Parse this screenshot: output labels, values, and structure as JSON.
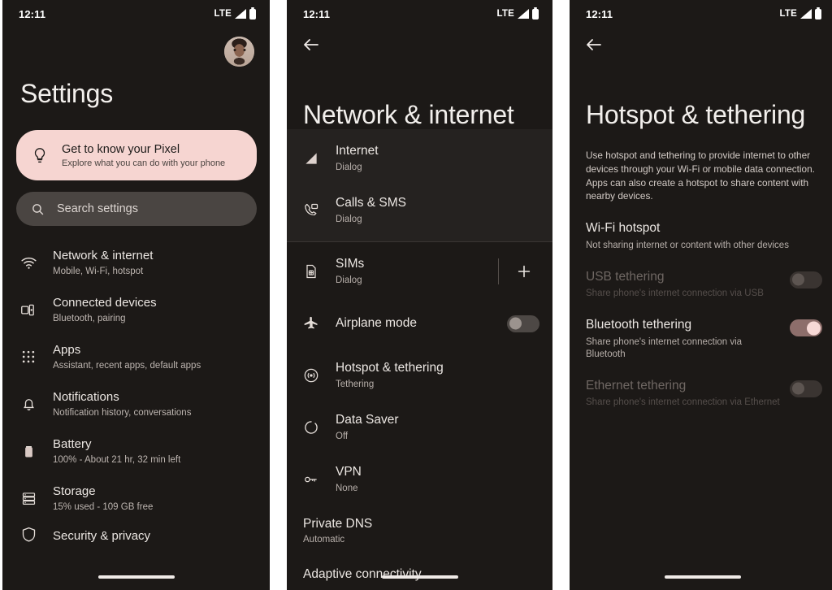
{
  "status_bar": {
    "time": "12:11",
    "network_label": "LTE",
    "signal_icon": "signal-bars-icon",
    "battery_icon": "battery-full-icon"
  },
  "colors": {
    "background": "#1c1917",
    "card_pink": "#f6d5d1",
    "search_bg": "#4a4542",
    "toggle_on_track": "#8d6e6b",
    "toggle_on_thumb": "#f7d9d6",
    "toggle_off_track": "#4d4845",
    "text_primary": "#ece7e3",
    "text_secondary": "#b7afaa"
  },
  "panel1": {
    "avatar": "user-avatar",
    "title": "Settings",
    "promo_card": {
      "icon": "lightbulb-icon",
      "title": "Get to know your Pixel",
      "subtitle": "Explore what you can do with your phone"
    },
    "search": {
      "icon": "search-icon",
      "placeholder": "Search settings"
    },
    "items": [
      {
        "icon": "wifi-icon",
        "title": "Network & internet",
        "subtitle": "Mobile, Wi-Fi, hotspot"
      },
      {
        "icon": "connected-devices-icon",
        "title": "Connected devices",
        "subtitle": "Bluetooth, pairing"
      },
      {
        "icon": "apps-grid-icon",
        "title": "Apps",
        "subtitle": "Assistant, recent apps, default apps"
      },
      {
        "icon": "bell-icon",
        "title": "Notifications",
        "subtitle": "Notification history, conversations"
      },
      {
        "icon": "battery-icon",
        "title": "Battery",
        "subtitle": "100% - About 21 hr, 32 min left"
      },
      {
        "icon": "storage-icon",
        "title": "Storage",
        "subtitle": "15% used - 109 GB free"
      }
    ],
    "cut_off_item": {
      "icon": "shield-icon",
      "title": "Security & privacy"
    }
  },
  "panel2": {
    "back_icon": "back-arrow-icon",
    "title": "Network & internet",
    "group_top": [
      {
        "icon": "signal-cellular-icon",
        "title": "Internet",
        "subtitle": "Dialog"
      },
      {
        "icon": "calls-sms-icon",
        "title": "Calls & SMS",
        "subtitle": "Dialog"
      }
    ],
    "items": [
      {
        "icon": "sim-card-icon",
        "title": "SIMs",
        "subtitle": "Dialog",
        "trailing": "add-button",
        "add_label": "+"
      },
      {
        "icon": "airplane-icon",
        "title": "Airplane mode",
        "subtitle": "",
        "trailing": "toggle",
        "toggle_state": "off"
      },
      {
        "icon": "hotspot-icon",
        "title": "Hotspot & tethering",
        "subtitle": "Tethering",
        "trailing": "none"
      },
      {
        "icon": "data-saver-icon",
        "title": "Data Saver",
        "subtitle": "Off",
        "trailing": "none"
      },
      {
        "icon": "vpn-key-icon",
        "title": "VPN",
        "subtitle": "None",
        "trailing": "none"
      }
    ],
    "plain_items": [
      {
        "title": "Private DNS",
        "subtitle": "Automatic"
      },
      {
        "title": "Adaptive connectivity",
        "subtitle": ""
      }
    ]
  },
  "panel3": {
    "back_icon": "back-arrow-icon",
    "title": "Hotspot & tethering",
    "description": "Use hotspot and tethering to provide internet to other devices through your Wi-Fi or mobile data connection. Apps can also create a hotspot to share content with nearby devices.",
    "wifi_hotspot": {
      "title": "Wi-Fi hotspot",
      "subtitle": "Not sharing internet or content with other devices"
    },
    "toggles": [
      {
        "title": "USB tethering",
        "subtitle": "Share phone's internet connection via USB",
        "state": "off",
        "disabled": true
      },
      {
        "title": "Bluetooth tethering",
        "subtitle": "Share phone's internet connection via Bluetooth",
        "state": "on",
        "disabled": false
      },
      {
        "title": "Ethernet tethering",
        "subtitle": "Share phone's internet connection via Ethernet",
        "state": "off",
        "disabled": true
      }
    ]
  }
}
